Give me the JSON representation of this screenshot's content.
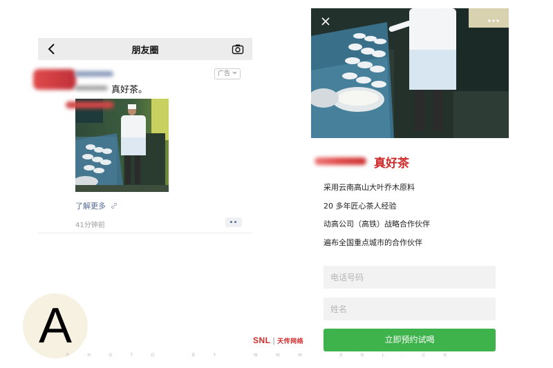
{
  "feed": {
    "header_title": "朋友圈",
    "ad_label": "广告",
    "post_text": "真好茶。",
    "learn_more": "了解更多",
    "time_ago": "41分钟前"
  },
  "badge_letter": "A",
  "watermark": {
    "logo": "SNL",
    "logo_cn": "天传网络",
    "text": "PHOTO BY WWW.SNL.CN"
  },
  "landing": {
    "title": "真好茶",
    "features": [
      "采用云南高山大叶乔木原料",
      "20 多年匠心茶人经验",
      "动高公司（高铁）战略合作伙伴",
      "遍布全国重点城市的合作伙伴"
    ],
    "phone_placeholder": "电话号码",
    "name_placeholder": "姓名",
    "cta_label": "立即预约试喝"
  },
  "colors": {
    "brand_red": "#cf2a2a",
    "cta_green": "#3eb34b",
    "link_blue": "#576b95"
  }
}
